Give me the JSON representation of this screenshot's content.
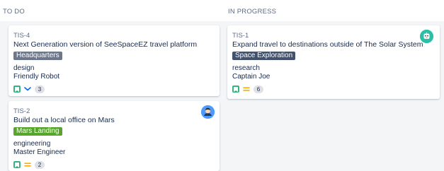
{
  "columns": [
    {
      "title": "TO DO",
      "cards": [
        {
          "key": "TIS-4",
          "summary": "Next Generation version of SeeSpaceEZ travel platform",
          "epic": {
            "label": "Headquarters",
            "color": "#6b778c"
          },
          "component": "design",
          "assignee": "Friendly Robot",
          "priority": "low",
          "estimate": "3",
          "avatar": null
        },
        {
          "key": "TIS-2",
          "summary": "Build out a local office on Mars",
          "epic": {
            "label": "Mars Landing",
            "color": "#57a52b"
          },
          "component": "engineering",
          "assignee": "Master Engineer",
          "priority": "medium",
          "estimate": "2",
          "avatar": "person-avatar-icon"
        }
      ]
    },
    {
      "title": "IN PROGRESS",
      "cards": [
        {
          "key": "TIS-1",
          "summary": "Expand travel to destinations outside of The Solar System",
          "epic": {
            "label": "Space Exploration",
            "color": "#42526e"
          },
          "component": "research",
          "assignee": "Captain Joe",
          "priority": "medium",
          "estimate": "6",
          "avatar": "robot-avatar-icon"
        }
      ]
    }
  ],
  "colors": {
    "story": "#36b37e",
    "priority_low": "#0065ff",
    "priority_medium": "#ffab00"
  }
}
